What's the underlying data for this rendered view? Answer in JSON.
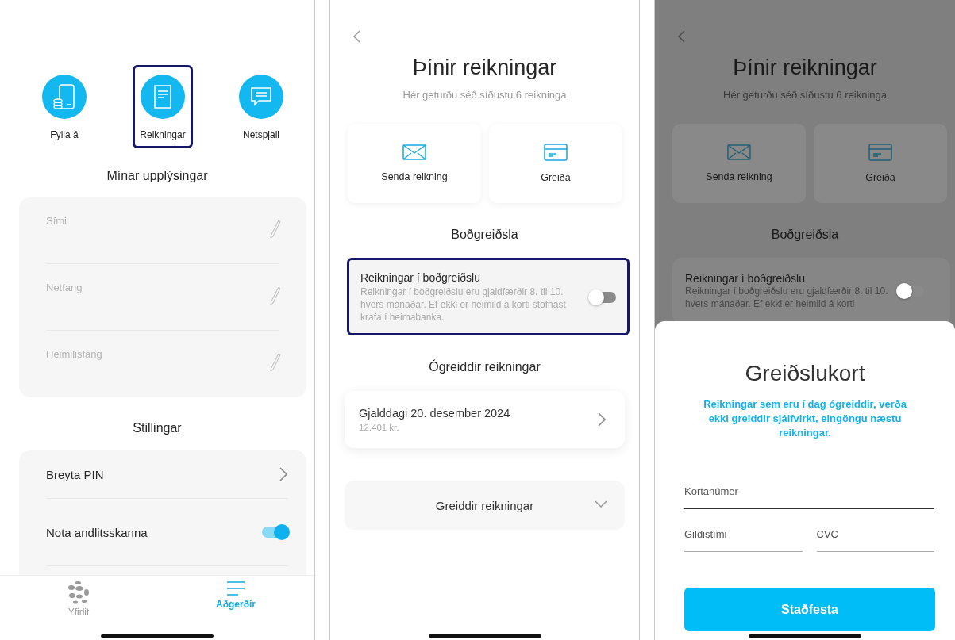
{
  "actions_screen": {
    "shortcuts": [
      {
        "label": "Fylla á",
        "selected": false
      },
      {
        "label": "Reikningar",
        "selected": true
      },
      {
        "label": "Netspjall",
        "selected": false
      }
    ],
    "info_title": "Mínar upplýsingar",
    "info_fields": [
      {
        "label": "Sími"
      },
      {
        "label": "Netfang"
      },
      {
        "label": "Heimilisfang"
      }
    ],
    "settings_title": "Stillingar",
    "settings": [
      {
        "kind": "link",
        "label": "Breyta PIN"
      },
      {
        "kind": "toggle",
        "label": "Nota andlitsskanna",
        "on": true
      }
    ],
    "tabs": [
      {
        "label": "Yfirlit",
        "selected": false
      },
      {
        "label": "Aðgerðir",
        "selected": true
      }
    ]
  },
  "bills_screen": {
    "title": "Þínir reikningar",
    "subtitle": "Hér geturðu séð síðustu 6 reikninga",
    "actions": [
      {
        "label": "Senda reikning"
      },
      {
        "label": "Greiða"
      }
    ],
    "autopay_title": "Boðgreiðsla",
    "autopay": {
      "label": "Reikningar í boðgreiðslu",
      "description": "Reikningar í boðgreiðslu eru gjaldfærðir 8. til 10. hvers mánaðar. Ef ekki er heimild á korti stofnast krafa í heimabanka.",
      "on": false,
      "highlighted": true
    },
    "unpaid_title": "Ógreiddir reikningar",
    "bills": [
      {
        "due": "Gjalddagi 20. desember 2024",
        "amount": "12.401 kr."
      }
    ],
    "paid_section": {
      "label": "Greiddir reikningar",
      "expanded": false
    }
  },
  "card_sheet_screen": {
    "background": {
      "title": "Þínir reikningar",
      "subtitle": "Hér geturðu séð síðustu 6 reikninga",
      "actions": [
        {
          "label": "Senda reikning"
        },
        {
          "label": "Greiða"
        }
      ],
      "autopay_title": "Boðgreiðsla",
      "autopay": {
        "label": "Reikningar í boðgreiðslu",
        "description_lines": [
          "Reikningar í boðgreiðslu eru gjaldfærðir 8. til 10.",
          "hvers mánaðar. Ef ekki er heimild á korti"
        ],
        "on": false
      }
    },
    "sheet": {
      "title": "Greiðslukort",
      "notice": "Reikningar sem eru í dag ógreiddir, verða ekki greiddir sjálfvirkt, eingöngu næstu reikningar.",
      "fields": [
        {
          "kind": "wide",
          "placeholder": "Kortanúmer"
        },
        {
          "kind": "narrow",
          "placeholder": "Gildistími"
        },
        {
          "kind": "narrow",
          "placeholder": "CVC"
        }
      ],
      "confirm_button": "Staðfesta"
    }
  }
}
